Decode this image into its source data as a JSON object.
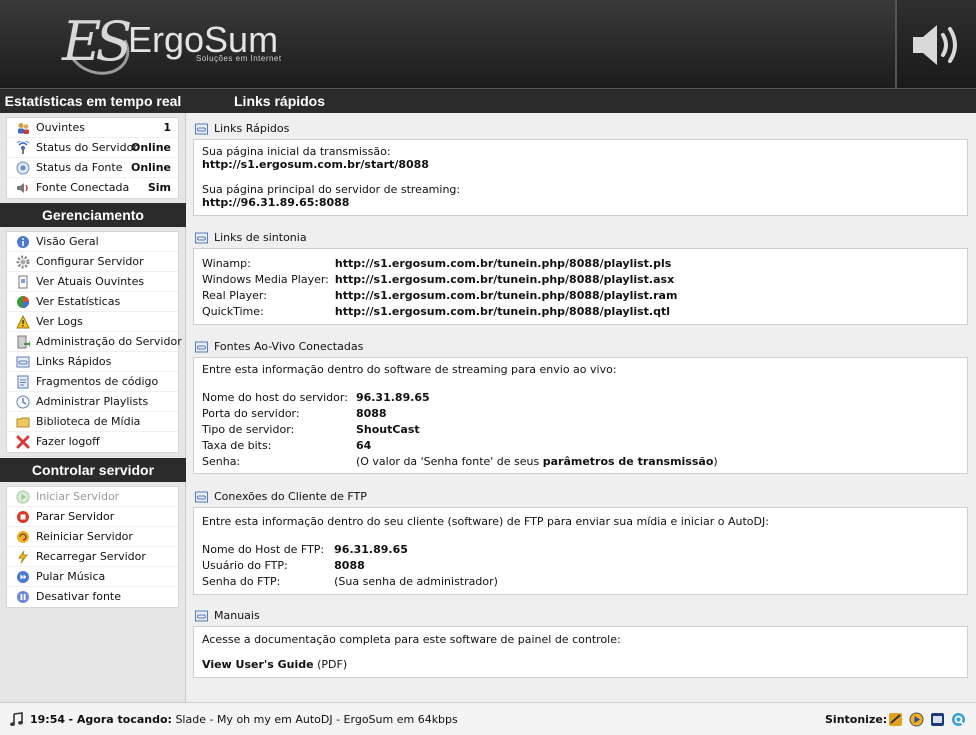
{
  "brand": {
    "mark": "ES",
    "name": "ErgoSum",
    "tagline": "Soluções em Internet"
  },
  "sidebar": {
    "stats_title": "Estatísticas em tempo real",
    "stats": [
      {
        "label": "Ouvintes",
        "value": "1",
        "icon": "listeners-icon"
      },
      {
        "label": "Status do Servidor",
        "value": "Online",
        "icon": "server-status-icon"
      },
      {
        "label": "Status da Fonte",
        "value": "Online",
        "icon": "source-status-icon"
      },
      {
        "label": "Fonte Conectada",
        "value": "Sim",
        "icon": "speaker-icon"
      }
    ],
    "manage_title": "Gerenciamento",
    "manage": [
      {
        "label": "Visão Geral",
        "icon": "info-icon"
      },
      {
        "label": "Configurar Servidor",
        "icon": "gear-icon"
      },
      {
        "label": "Ver Atuais Ouvintes",
        "icon": "document-icon"
      },
      {
        "label": "Ver Estatísticas",
        "icon": "pie-chart-icon"
      },
      {
        "label": "Ver Logs",
        "icon": "warning-icon"
      },
      {
        "label": "Administração do Servidor",
        "icon": "server-admin-icon"
      },
      {
        "label": "Links Rápidos",
        "icon": "links-icon"
      },
      {
        "label": "Fragmentos de código",
        "icon": "code-icon"
      },
      {
        "label": "Administrar Playlists",
        "icon": "playlist-icon"
      },
      {
        "label": "Biblioteca de Mídia",
        "icon": "folder-icon"
      },
      {
        "label": "Fazer logoff",
        "icon": "logoff-icon"
      }
    ],
    "control_title": "Controlar servidor",
    "control": [
      {
        "label": "Iniciar Servidor",
        "icon": "play-icon",
        "disabled": true
      },
      {
        "label": "Parar Servidor",
        "icon": "stop-icon"
      },
      {
        "label": "Reiniciar Servidor",
        "icon": "restart-icon"
      },
      {
        "label": "Recarregar Servidor",
        "icon": "lightning-icon"
      },
      {
        "label": "Pular Música",
        "icon": "skip-icon"
      },
      {
        "label": "Desativar fonte",
        "icon": "pause-icon"
      }
    ]
  },
  "main": {
    "title": "Links rápidos",
    "quick": {
      "title": "Links Rápidos",
      "start_label": "Sua página inicial da transmissão:",
      "start_url": "http://s1.ergosum.com.br/start/8088",
      "server_label": "Sua página principal do servidor de streaming:",
      "server_url": "http://96.31.89.65:8088"
    },
    "tunein": {
      "title": "Links de sintonia",
      "rows": [
        {
          "label": "Winamp:",
          "url": "http://s1.ergosum.com.br/tunein.php/8088/playlist.pls"
        },
        {
          "label": "Windows Media Player:",
          "url": "http://s1.ergosum.com.br/tunein.php/8088/playlist.asx"
        },
        {
          "label": "Real Player:",
          "url": "http://s1.ergosum.com.br/tunein.php/8088/playlist.ram"
        },
        {
          "label": "QuickTime:",
          "url": "http://s1.ergosum.com.br/tunein.php/8088/playlist.qtl"
        }
      ]
    },
    "live": {
      "title": "Fontes Ao-Vivo Conectadas",
      "intro": "Entre esta informação dentro do software de streaming para envio ao vivo:",
      "rows": [
        {
          "label": "Nome do host do servidor:",
          "value": "96.31.89.65"
        },
        {
          "label": "Porta do servidor:",
          "value": "8088"
        },
        {
          "label": "Tipo de servidor:",
          "value": "ShoutCast"
        },
        {
          "label": "Taxa de bits:",
          "value": "64"
        }
      ],
      "password_label": "Senha:",
      "password_pre": "(O valor da 'Senha fonte' de seus ",
      "password_link": "parâmetros de transmissão",
      "password_post": ")"
    },
    "ftp": {
      "title": "Conexões do Cliente de FTP",
      "intro": "Entre esta informação dentro do seu cliente (software) de FTP para enviar sua mídia e iniciar o AutoDJ:",
      "rows": [
        {
          "label": "Nome do Host de FTP:",
          "value": "96.31.89.65"
        },
        {
          "label": "Usuário do FTP:",
          "value": "8088"
        }
      ],
      "password_label": "Senha do FTP:",
      "password_value": "(Sua senha de administrador)"
    },
    "manuals": {
      "title": "Manuais",
      "intro": "Acesse a documentação completa para este software de painel de controle:",
      "guide": "View User's Guide",
      "guide_suffix": " (PDF)"
    }
  },
  "footer": {
    "time": "19:54",
    "now_playing_label": "- Agora tocando:",
    "track": "Slade - My oh my em AutoDJ - ErgoSum em 64kbps",
    "tune_label": "Sintonize:",
    "tune_icons": [
      "winamp-icon",
      "media-player-icon",
      "real-player-icon",
      "quicktime-icon"
    ]
  }
}
